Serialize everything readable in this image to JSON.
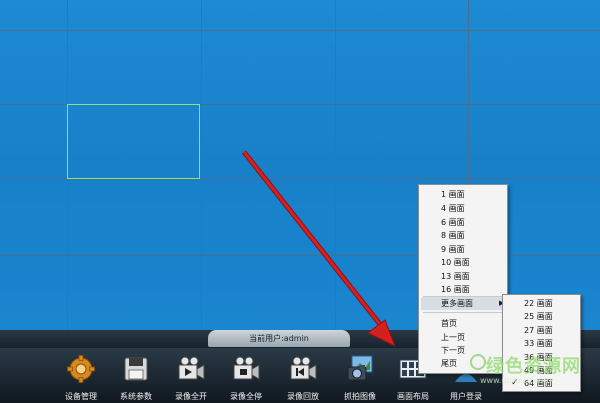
{
  "status": {
    "current_user": "当前用户:admin"
  },
  "toolbar": {
    "device_manage": "设备管理",
    "system_params": "系统参数",
    "record_all_on": "录像全开",
    "record_all_stop": "录像全停",
    "playback": "录像回放",
    "capture_image": "抓拍图像",
    "screen_layout": "画面布局",
    "user_login": "用户登录"
  },
  "layout_menu": {
    "items": [
      "1 画面",
      "4 画面",
      "6 画面",
      "8 画面",
      "9 画面",
      "10 画面",
      "13 画面",
      "16 画面"
    ],
    "more": "更多画面",
    "first_page": "首页",
    "prev_page": "上一页",
    "next_page": "下一页",
    "last_page": "尾页"
  },
  "more_menu": {
    "items": [
      "22 画面",
      "25 画面",
      "27 画面",
      "33 画面",
      "36 画面",
      "49 画面",
      "64 画面"
    ],
    "checked": "64 画面"
  },
  "watermark": {
    "text": "绿色资源网",
    "url": "www.downcc.com"
  },
  "colors": {
    "screen_blue": "#1a86cf",
    "selection": "#8fe07f",
    "arrow": "#d62020"
  }
}
